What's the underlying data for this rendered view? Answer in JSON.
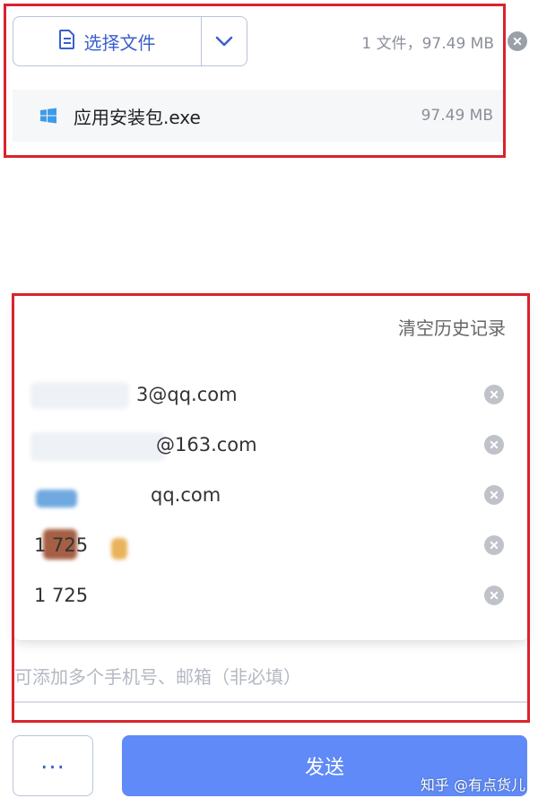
{
  "file_picker": {
    "select_label": "选择文件",
    "summary": "1 文件，97.49 MB",
    "icons": {
      "select": "document-icon",
      "dropdown": "chevron-down-icon",
      "clear": "close-circle-icon"
    }
  },
  "file": {
    "name": "应用安装包.exe",
    "size": "97.49 MB",
    "icon": "windows-icon"
  },
  "history": {
    "clear_label": "清空历史记录",
    "items": [
      {
        "text": "3@qq.com"
      },
      {
        "text": "@163.com"
      },
      {
        "text": "qq.com"
      },
      {
        "text": "1     725"
      },
      {
        "text": "1     725"
      }
    ]
  },
  "recipient": {
    "placeholder": "可添加多个手机号、邮箱（非必填）"
  },
  "actions": {
    "more_label": "...",
    "send_label": "发送"
  },
  "watermark": "知乎 @有点货儿",
  "colors": {
    "accent": "#3a5fcd",
    "send_button": "#5f8af7",
    "annotation": "#d9232d"
  }
}
